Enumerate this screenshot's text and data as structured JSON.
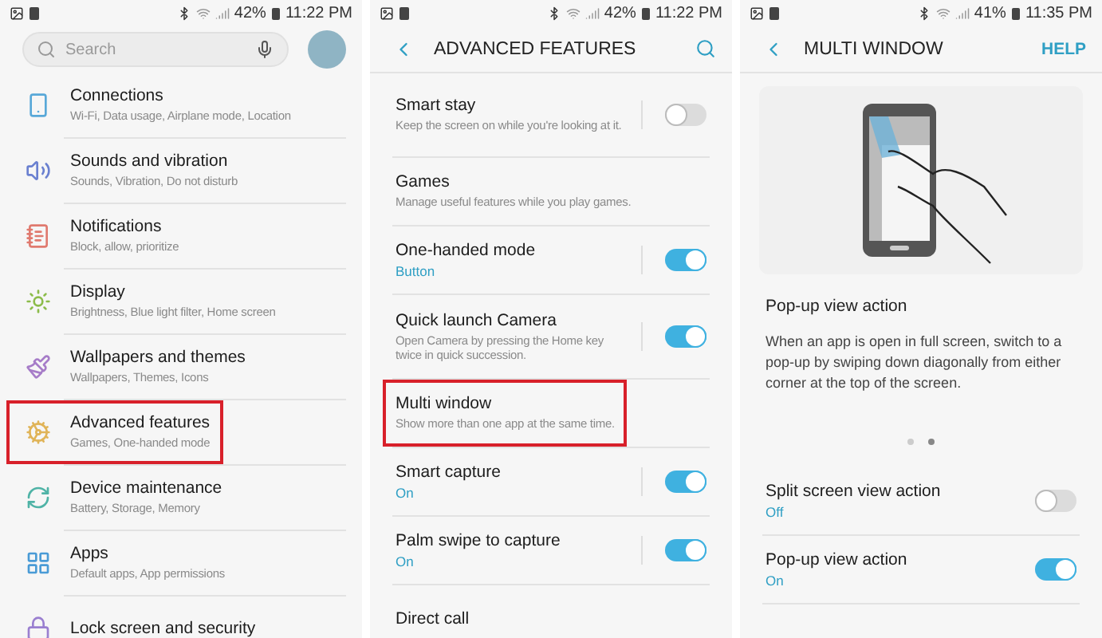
{
  "settings_home": {
    "status_bar": {
      "battery": "42%",
      "time": "11:22 PM"
    },
    "search": {
      "placeholder": "Search"
    },
    "items": [
      {
        "title": "Connections",
        "description": "Wi-Fi, Data usage, Airplane mode, Location",
        "color": "#58a8d8",
        "highlighted": false
      },
      {
        "title": "Sounds and vibration",
        "description": "Sounds, Vibration, Do not disturb",
        "color": "#6a80d0",
        "highlighted": false
      },
      {
        "title": "Notifications",
        "description": "Block, allow, prioritize",
        "color": "#e07a6f",
        "highlighted": false
      },
      {
        "title": "Display",
        "description": "Brightness, Blue light filter, Home screen",
        "color": "#8cbc4a",
        "highlighted": false
      },
      {
        "title": "Wallpapers and themes",
        "description": "Wallpapers, Themes, Icons",
        "color": "#a67cc8",
        "highlighted": false
      },
      {
        "title": "Advanced features",
        "description": "Games, One-handed mode",
        "color": "#e0b458",
        "highlighted": true
      },
      {
        "title": "Device maintenance",
        "description": "Battery, Storage, Memory",
        "color": "#4fb3a6",
        "highlighted": false
      },
      {
        "title": "Apps",
        "description": "Default apps, App permissions",
        "color": "#4a9bd6",
        "highlighted": false
      },
      {
        "title": "Lock screen and security",
        "color": "#9a7fd0",
        "highlighted": false
      }
    ]
  },
  "advanced_features": {
    "status_bar": {
      "battery": "42%",
      "time": "11:22 PM"
    },
    "title": "ADVANCED FEATURES",
    "items": [
      {
        "kind": "toggle",
        "title": "Smart stay",
        "description": "Keep the screen on while you're looking at it.",
        "on": false,
        "highlighted": false
      },
      {
        "kind": "link",
        "title": "Games",
        "description": "Manage useful features while you play games.",
        "highlighted": false
      },
      {
        "kind": "toggle",
        "title": "One-handed mode",
        "status": "Button",
        "on": true,
        "highlighted": false
      },
      {
        "kind": "toggle",
        "title": "Quick launch Camera",
        "description": "Open Camera by pressing the Home key twice in quick succession.",
        "on": true,
        "highlighted": false
      },
      {
        "kind": "link",
        "title": "Multi window",
        "description": "Show more than one app at the same time.",
        "highlighted": true
      },
      {
        "kind": "toggle",
        "title": "Smart capture",
        "status": "On",
        "on": true,
        "highlighted": false
      },
      {
        "kind": "toggle",
        "title": "Palm swipe to capture",
        "status": "On",
        "on": true,
        "highlighted": false
      },
      {
        "kind": "link",
        "title": "Direct call",
        "highlighted": false
      }
    ]
  },
  "multi_window": {
    "status_bar": {
      "battery": "41%",
      "time": "11:35 PM"
    },
    "title": "MULTI WINDOW",
    "help": "HELP",
    "heading": "Pop-up view action",
    "body": "When an app is open in full screen, switch to a pop-up by swiping down diagonally from either corner at the top of the screen.",
    "page_dots": [
      {
        "selected": false
      },
      {
        "selected": true
      }
    ],
    "items": [
      {
        "kind": "toggle",
        "title": "Split screen view action",
        "status": "Off",
        "on": false,
        "highlighted": false
      },
      {
        "kind": "toggle",
        "title": "Pop-up view action",
        "status": "On",
        "on": true,
        "highlighted": false
      }
    ]
  }
}
